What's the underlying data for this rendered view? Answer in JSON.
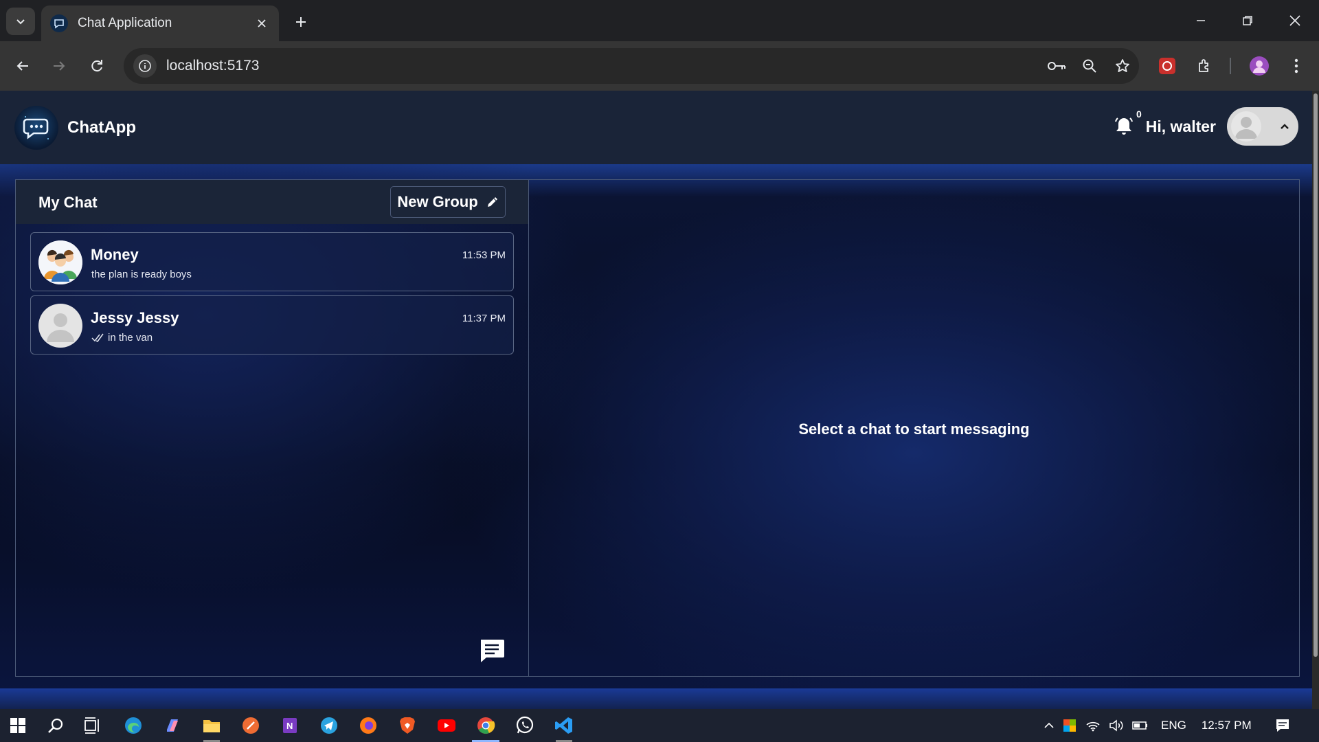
{
  "browser": {
    "tab_title": "Chat Application",
    "url": "localhost:5173"
  },
  "app": {
    "brand": "ChatApp",
    "notification_count": "0",
    "greeting": "Hi, walter"
  },
  "sidebar": {
    "title": "My Chat",
    "new_group_label": "New Group",
    "chats": [
      {
        "name": "Money",
        "preview": "the plan is ready boys",
        "time": "11:53 PM",
        "avatar": "group-avatar"
      },
      {
        "name": "Jessy Jessy",
        "preview": "in the van",
        "time": "11:37 PM",
        "avatar": "default-user-avatar",
        "read_receipt": "double-check-icon"
      }
    ]
  },
  "main": {
    "empty_message": "Select a chat to start messaging"
  },
  "taskbar": {
    "language": "ENG",
    "clock": "12:57 PM"
  },
  "colors": {
    "header_bg": "#1a2438",
    "panel_border": "#4c5a78",
    "body_gradient_center": "#152a6a"
  }
}
